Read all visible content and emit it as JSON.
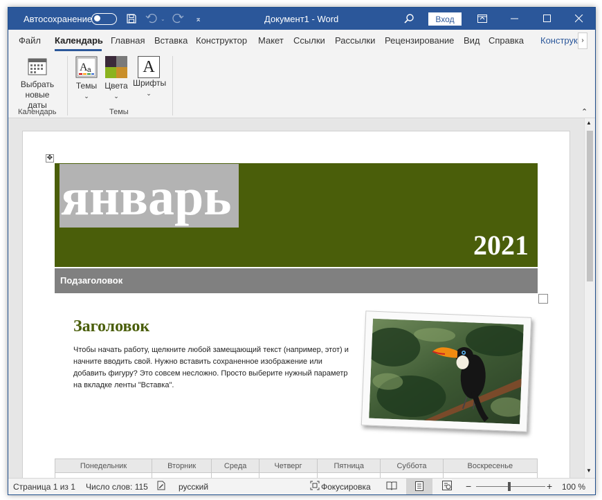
{
  "titlebar": {
    "autosave_label": "Автосохранение",
    "doc_title": "Документ1  -  Word",
    "signin_label": "Вход"
  },
  "tabs": [
    "Файл",
    "Календарь",
    "Главная",
    "Вставка",
    "Конструктор",
    "Макет",
    "Ссылки",
    "Рассылки",
    "Рецензирование",
    "Вид",
    "Справка",
    "Конструк"
  ],
  "active_tab": "Календарь",
  "ribbon": {
    "select_dates_line1": "Выбрать",
    "select_dates_line2": "новые даты",
    "themes_label": "Темы",
    "colors_label": "Цвета",
    "fonts_label": "Шрифты",
    "group_calendar": "Календарь",
    "group_themes": "Темы",
    "fonts_glyph": "A"
  },
  "document": {
    "month": "январь",
    "year": "2021",
    "subheading": "Подзаголовок",
    "heading": "Заголовок",
    "body": "Чтобы начать работу, щелкните любой замещающий текст (например, этот) и начните вводить свой. Нужно вставить сохраненное изображение или добавить фигуру? Это совсем несложно. Просто выберите нужный параметр на вкладке ленты \"Вставка\".",
    "weekdays": [
      "Понедельник",
      "Вторник",
      "Среда",
      "Четверг",
      "Пятница",
      "Суббота",
      "Воскресенье"
    ]
  },
  "statusbar": {
    "page": "Страница 1 из 1",
    "words": "Число слов: 115",
    "language": "русский",
    "focus": "Фокусировка",
    "zoom": "100 %",
    "zoom_minus": "−",
    "zoom_plus": "+"
  },
  "colors": {
    "titlebar": "#2b579a",
    "banner": "#4a5e0a",
    "subbar": "#808080"
  }
}
